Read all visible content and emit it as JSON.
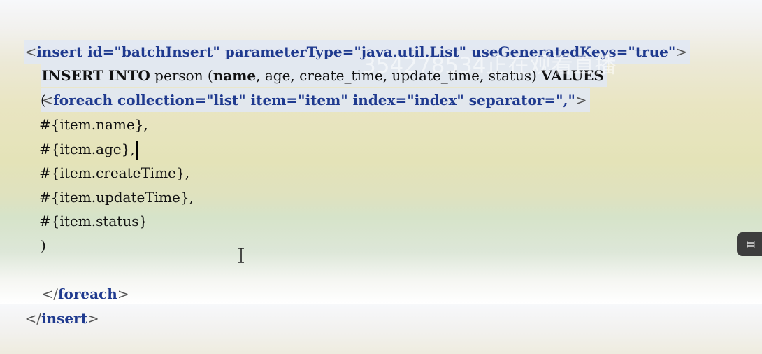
{
  "code": {
    "line1": {
      "open_bracket": "<",
      "tag": "insert",
      "attr_id": " id=",
      "id_value": "\"batchInsert\"",
      "attr_param": " parameterType=",
      "param_value": "\"java.util.List\"",
      "attr_keys": " useGeneratedKeys=",
      "keys_value": "\"true\"",
      "close_bracket": ">"
    },
    "line2": {
      "sql_kw1": "INSERT INTO",
      "sql_table": " person (",
      "col_name": "name",
      "col_rest": ", age, create_time, update_time, status) ",
      "sql_kw2": "VALUES"
    },
    "line3": {
      "open_bracket": "<",
      "tag": "foreach",
      "attr_collection": " collection=",
      "collection_value": "\"list\"",
      "attr_item": " item=",
      "item_value": "\"item\"",
      "attr_index": " index=",
      "index_value": "\"index\"",
      "attr_separator": " separator=",
      "separator_value": "\",\"",
      "close_bracket": ">"
    },
    "line4": "(",
    "line5": "#{item.name},",
    "line6": "#{item.age},",
    "line7": "#{item.createTime},",
    "line8": "#{item.updateTime},",
    "line9": "#{item.status}",
    "line10": ")",
    "line11": {
      "open_bracket": "</",
      "tag": "foreach",
      "close_bracket": ">"
    },
    "line12": {
      "open_bracket": "</",
      "tag": "insert",
      "close_bracket": ">"
    }
  },
  "overlay": {
    "watermark": "354278534正在观看直播",
    "side_tab_icon": "▤"
  },
  "icons": {
    "text_cursor": "i-beam-cursor-icon",
    "side_tab": "panel-icon"
  }
}
